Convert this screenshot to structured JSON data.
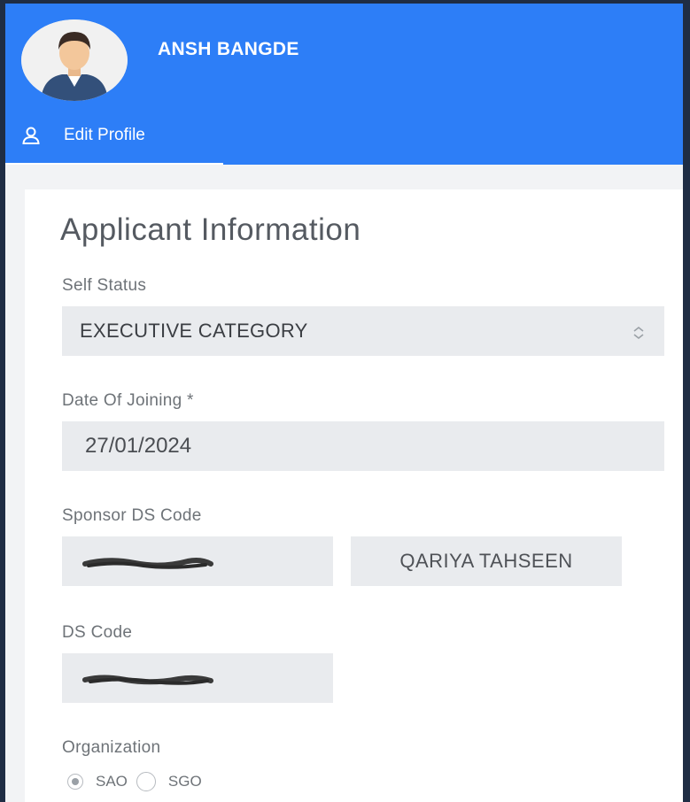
{
  "header": {
    "user_name": "ANSH BANGDE",
    "edit_profile_label": "Edit Profile",
    "background_color": "#2d7ef7"
  },
  "form": {
    "title": "Applicant Information",
    "self_status": {
      "label": "Self Status",
      "value": "EXECUTIVE CATEGORY"
    },
    "date_of_joining": {
      "label": "Date Of Joining *",
      "value": "27/01/2024"
    },
    "sponsor_ds_code": {
      "label": "Sponsor DS Code",
      "sponsor_name": "QARIYA TAHSEEN"
    },
    "ds_code": {
      "label": "DS Code"
    },
    "organization": {
      "label": "Organization",
      "options": [
        "SAO",
        "SGO"
      ],
      "selected": "SAO"
    }
  },
  "icons": {
    "edit_profile": "user-icon",
    "select": "chevron-updown-icon"
  }
}
